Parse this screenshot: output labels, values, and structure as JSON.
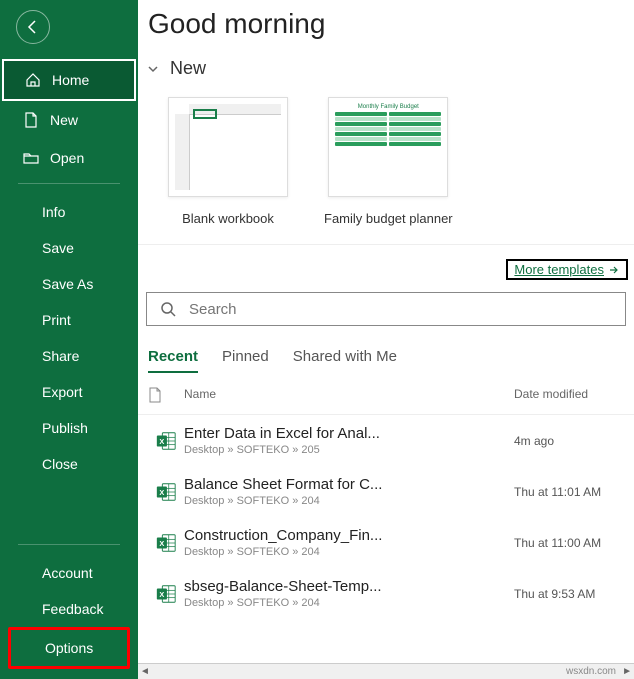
{
  "header": {
    "greeting": "Good morning"
  },
  "sidebar": {
    "nav": [
      {
        "label": "Home",
        "icon": "home-icon",
        "selected": true
      },
      {
        "label": "New",
        "icon": "new-doc-icon"
      },
      {
        "label": "Open",
        "icon": "open-folder-icon"
      }
    ],
    "subnav": [
      "Info",
      "Save",
      "Save As",
      "Print",
      "Share",
      "Export",
      "Publish",
      "Close"
    ],
    "bottomnav": [
      "Account",
      "Feedback",
      "Options"
    ],
    "highlight": "Options"
  },
  "new_section": {
    "title": "New",
    "templates": [
      {
        "label": "Blank workbook",
        "kind": "blank"
      },
      {
        "label": "Family budget planner",
        "kind": "budget"
      }
    ],
    "more_link": "More templates",
    "budget_thumb_title": "Monthly Family Budget"
  },
  "search": {
    "placeholder": "Search"
  },
  "tabs": {
    "items": [
      "Recent",
      "Pinned",
      "Shared with Me"
    ],
    "active": "Recent"
  },
  "list": {
    "columns": {
      "name": "Name",
      "date": "Date modified"
    },
    "rows": [
      {
        "name": "Enter Data in Excel for Anal...",
        "path": "Desktop » SOFTEKO » 205",
        "date": "4m ago"
      },
      {
        "name": "Balance Sheet Format for C...",
        "path": "Desktop » SOFTEKO » 204",
        "date": "Thu at 11:01 AM"
      },
      {
        "name": "Construction_Company_Fin...",
        "path": "Desktop » SOFTEKO » 204",
        "date": "Thu at 11:00 AM"
      },
      {
        "name": "sbseg-Balance-Sheet-Temp...",
        "path": "Desktop » SOFTEKO » 204",
        "date": "Thu at 9:53 AM"
      }
    ]
  },
  "watermark": "wsxdn.com"
}
